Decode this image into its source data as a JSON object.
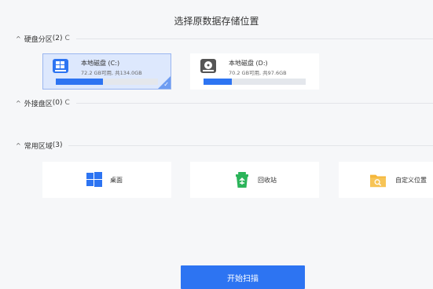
{
  "title": "选择原数据存储位置",
  "sections": {
    "hdd": {
      "label": "硬盘分区",
      "count": "2",
      "caret": "^",
      "refresh": "C"
    },
    "external": {
      "label": "外接盘区",
      "count": "0",
      "caret": "^",
      "refresh": "C"
    },
    "common": {
      "label": "常用区域",
      "count": "3",
      "caret": "^"
    }
  },
  "disks": [
    {
      "name": "本地磁盘 (C:)",
      "info": "72.2 GB可用, 共134.0GB",
      "used_fraction": 0.46,
      "selected": true,
      "icon": "windows-drive-icon"
    },
    {
      "name": "本地磁盘 (D:)",
      "info": "70.2 GB可用, 共97.6GB",
      "used_fraction": 0.28,
      "selected": false,
      "icon": "drive-icon"
    }
  ],
  "locations": [
    {
      "label": "桌面",
      "icon": "windows-desktop-icon"
    },
    {
      "label": "回收站",
      "icon": "recycle-bin-icon"
    },
    {
      "label": "自定义位置",
      "icon": "folder-search-icon"
    }
  ],
  "scan_button": "开始扫描",
  "colors": {
    "accent": "#2d74f2",
    "selected_bg": "#dde8fd",
    "selected_border": "#9ab6f0",
    "recycle_green": "#2bb45a",
    "folder_yellow": "#f5b63a"
  }
}
